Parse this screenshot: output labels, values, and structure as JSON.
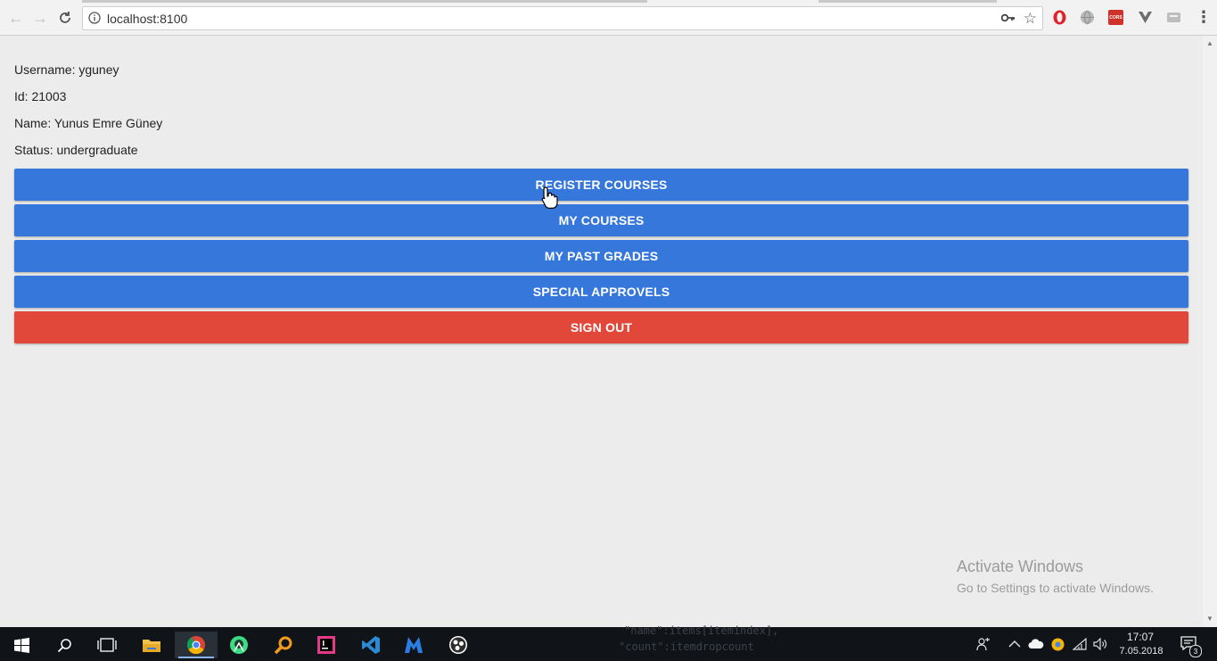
{
  "browser": {
    "url": "localhost:8100",
    "extension_badge": "CORS"
  },
  "profile": {
    "username_line": "Username: yguney",
    "id_line": "Id: 21003",
    "name_line": "Name: Yunus Emre Güney",
    "status_line": "Status: undergraduate"
  },
  "actions": {
    "register_courses": "REGISTER COURSES",
    "my_courses": "MY COURSES",
    "my_past_grades": "MY PAST GRADES",
    "special_approvels": "SPECIAL APPROVELS",
    "sign_out": "SIGN OUT"
  },
  "watermark": {
    "title": "Activate Windows",
    "subtitle": "Go to Settings to activate Windows."
  },
  "taskbar": {
    "background_code_1": "\"name\":items[itemindex],",
    "background_code_2": "\"count\":itemdropcount",
    "time": "17:07",
    "date": "7.05.2018",
    "notification_count": "3"
  },
  "colors": {
    "primary": "#3677db",
    "danger": "#e2483a",
    "page_bg": "#ececec"
  },
  "icons": [
    "back-icon",
    "forward-icon",
    "reload-icon",
    "info-icon",
    "key-icon",
    "star-icon",
    "opera-icon",
    "globe-icon",
    "cors-icon",
    "vue-icon",
    "extension-icon",
    "menu-icon",
    "windows-start-icon",
    "search-icon",
    "task-view-icon",
    "file-explorer-icon",
    "chrome-icon",
    "android-studio-icon",
    "search-app-icon",
    "intellij-icon",
    "vscode-icon",
    "malwarebytes-icon",
    "obs-icon",
    "people-icon",
    "chevron-up-icon",
    "onedrive-icon",
    "chrome-tray-icon",
    "wifi-icon",
    "volume-icon",
    "notification-icon"
  ]
}
